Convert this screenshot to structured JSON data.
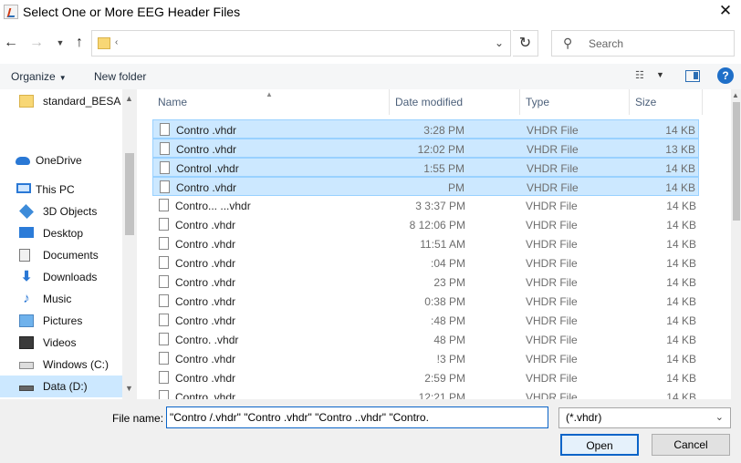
{
  "window": {
    "title": "Select One or More EEG Header Files",
    "close": "✕"
  },
  "address": {
    "path": "‹"
  },
  "search": {
    "placeholder": "Search"
  },
  "toolbar": {
    "organize": "Organize",
    "new_folder": "New folder"
  },
  "nav_pane": {
    "items": [
      {
        "label": "standard_BESA",
        "icon": "folder-icon"
      },
      {
        "label": "OneDrive",
        "icon": "cloud-icon"
      },
      {
        "label": "This PC",
        "icon": "computer-icon"
      },
      {
        "label": "3D Objects",
        "icon": "cube-icon"
      },
      {
        "label": "Desktop",
        "icon": "desktop-icon"
      },
      {
        "label": "Documents",
        "icon": "document-icon"
      },
      {
        "label": "Downloads",
        "icon": "download-icon"
      },
      {
        "label": "Music",
        "icon": "music-note-icon"
      },
      {
        "label": "Pictures",
        "icon": "picture-icon"
      },
      {
        "label": "Videos",
        "icon": "video-icon"
      },
      {
        "label": "Windows (C:)",
        "icon": "windows-drive-icon"
      },
      {
        "label": "Data (D:)",
        "icon": "drive-icon"
      }
    ]
  },
  "file_list": {
    "columns": [
      "Name",
      "Date modified",
      "Type",
      "Size"
    ],
    "rows": [
      {
        "name": "Contro .vhdr",
        "date": "3:28 PM",
        "type": "VHDR File",
        "size": "14 KB",
        "selected": true
      },
      {
        "name": "Contro .vhdr",
        "date": "12:02 PM",
        "type": "VHDR File",
        "size": "13 KB",
        "selected": true
      },
      {
        "name": "Control .vhdr",
        "date": "1:55 PM",
        "type": "VHDR File",
        "size": "14 KB",
        "selected": true
      },
      {
        "name": "Contro .vhdr",
        "date": "PM",
        "type": "VHDR File",
        "size": "14 KB",
        "selected": true
      },
      {
        "name": "Contro... ...vhdr",
        "date": "3 3:37 PM",
        "type": "VHDR File",
        "size": "14 KB",
        "selected": false
      },
      {
        "name": "Contro .vhdr",
        "date": "8 12:06 PM",
        "type": "VHDR File",
        "size": "14 KB",
        "selected": false
      },
      {
        "name": "Contro .vhdr",
        "date": "11:51 AM",
        "type": "VHDR File",
        "size": "14 KB",
        "selected": false
      },
      {
        "name": "Contro .vhdr",
        "date": ":04 PM",
        "type": "VHDR File",
        "size": "14 KB",
        "selected": false
      },
      {
        "name": "Contro .vhdr",
        "date": "23 PM",
        "type": "VHDR File",
        "size": "14 KB",
        "selected": false
      },
      {
        "name": "Contro .vhdr",
        "date": "0:38 PM",
        "type": "VHDR File",
        "size": "14 KB",
        "selected": false
      },
      {
        "name": "Contro .vhdr",
        "date": ":48 PM",
        "type": "VHDR File",
        "size": "14 KB",
        "selected": false
      },
      {
        "name": "Contro. .vhdr",
        "date": "48 PM",
        "type": "VHDR File",
        "size": "14 KB",
        "selected": false
      },
      {
        "name": "Contro .vhdr",
        "date": "!3 PM",
        "type": "VHDR File",
        "size": "14 KB",
        "selected": false
      },
      {
        "name": "Contro .vhdr",
        "date": "2:59 PM",
        "type": "VHDR File",
        "size": "14 KB",
        "selected": false
      },
      {
        "name": "Contro .vhdr",
        "date": "12:21 PM",
        "type": "VHDR File",
        "size": "14 KB",
        "selected": false
      }
    ]
  },
  "footer": {
    "file_name_label": "File name:",
    "file_name_value": "\"Contro /.vhdr\" \"Contro .vhdr\" \"Contro ..vhdr\" \"Contro.",
    "filter": "(*.vhdr)",
    "open": "Open",
    "cancel": "Cancel"
  },
  "colors": {
    "selection": "#cce8ff",
    "selection_border": "#99d1ff",
    "accent": "#0a64c8"
  }
}
